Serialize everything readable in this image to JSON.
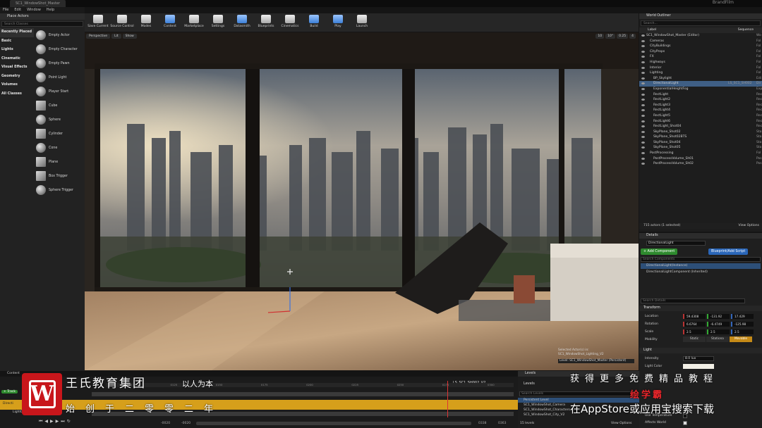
{
  "window": {
    "tab_title": "SC1_WindowShot_Master",
    "brand": "BrandFilm"
  },
  "menu": [
    "File",
    "Edit",
    "Window",
    "Help"
  ],
  "place_actors": {
    "title": "Place Actors",
    "search_placeholder": "Search Classes",
    "categories": [
      "Recently Placed",
      "Basic",
      "Lights",
      "Cinematic",
      "Visual Effects",
      "Geometry",
      "Volumes",
      "All Classes"
    ],
    "actors": [
      "Empty Actor",
      "Empty Character",
      "Empty Pawn",
      "Point Light",
      "Player Start",
      "Cube",
      "Sphere",
      "Cylinder",
      "Cone",
      "Plane",
      "Box Trigger",
      "Sphere Trigger"
    ]
  },
  "toolbar": [
    {
      "label": "Save Current",
      "icon": "save-icon"
    },
    {
      "label": "Source Control",
      "icon": "source-control-icon"
    },
    {
      "label": "Modes",
      "icon": "modes-icon"
    },
    {
      "label": "Content",
      "icon": "content-icon"
    },
    {
      "label": "Marketplace",
      "icon": "marketplace-icon"
    },
    {
      "label": "Settings",
      "icon": "settings-icon"
    },
    {
      "label": "Datasmith",
      "icon": "datasmith-icon"
    },
    {
      "label": "Blueprints",
      "icon": "blueprints-icon"
    },
    {
      "label": "Cinematics",
      "icon": "cinematics-icon"
    },
    {
      "label": "Build",
      "icon": "build-icon"
    },
    {
      "label": "Play",
      "icon": "play-icon"
    },
    {
      "label": "Launch",
      "icon": "launch-icon"
    }
  ],
  "viewport": {
    "perspective": "Perspective",
    "lit": "Lit",
    "show": "Show",
    "snap_grid": "10",
    "snap_angle": "10°",
    "snap_scale": "0.25",
    "cam_speed": "4",
    "info_selected": "Selected Actor(s) in:",
    "info_level": "SC1_WindowShot_Lighting_V2",
    "level_label": "Level:  SC1_WindowShot_Master (Persistent)"
  },
  "outliner": {
    "title": "World Outliner",
    "search_placeholder": "Search...",
    "col_label": "Label",
    "col_sequence": "Sequence",
    "rows": [
      {
        "label": "SC1_WindowShot_Master (Editor)",
        "seq": "",
        "type": "Wo"
      },
      {
        "label": "Cameras",
        "seq": "",
        "type": "Fol"
      },
      {
        "label": "CityBuildings",
        "seq": "",
        "type": "Fol"
      },
      {
        "label": "CityProps",
        "seq": "",
        "type": "Fol"
      },
      {
        "label": "FX",
        "seq": "",
        "type": "Fol"
      },
      {
        "label": "Highways",
        "seq": "",
        "type": "Fol"
      },
      {
        "label": "Interior",
        "seq": "",
        "type": "Fol"
      },
      {
        "label": "Lighting",
        "seq": "",
        "type": "Fol"
      },
      {
        "label": "BP_Skylight",
        "seq": "",
        "type": "Edi"
      },
      {
        "label": "DirectionalLight",
        "seq": "LS_SC1_SH002",
        "type": "Dir"
      },
      {
        "label": "ExponentialHeightFog",
        "seq": "",
        "type": "Exp"
      },
      {
        "label": "RectLight",
        "seq": "",
        "type": "Rec"
      },
      {
        "label": "RectLight2",
        "seq": "",
        "type": "Rec"
      },
      {
        "label": "RectLight3",
        "seq": "",
        "type": "Rec"
      },
      {
        "label": "RectLight4",
        "seq": "",
        "type": "Rec"
      },
      {
        "label": "RectLight5",
        "seq": "",
        "type": "Rec"
      },
      {
        "label": "RectLight6",
        "seq": "",
        "type": "Rec"
      },
      {
        "label": "RectLight_Shot04",
        "seq": "",
        "type": "Rec"
      },
      {
        "label": "SkyPlane_Shot02",
        "seq": "",
        "type": "Sta"
      },
      {
        "label": "SkyPlane_Shot02BTS",
        "seq": "",
        "type": "Sta"
      },
      {
        "label": "SkyPlane_Shot04",
        "seq": "",
        "type": "Sta"
      },
      {
        "label": "SkyPlane_Shot05",
        "seq": "",
        "type": "Sta"
      },
      {
        "label": "PostProcessing",
        "seq": "",
        "type": "Fol"
      },
      {
        "label": "PostProcessVolume_Sh01",
        "seq": "",
        "type": "Pos"
      },
      {
        "label": "PostProcessVolume_Sh02",
        "seq": "",
        "type": "Pos"
      }
    ],
    "footer": "715 actors (1 selected)",
    "view_options": "View Options"
  },
  "details": {
    "title": "Details",
    "name_value": "DirectionalLight",
    "add_component": "+ Add Component",
    "blueprint_btn": "Blueprint/Add Script",
    "search_components": "Search Components",
    "component_root": "DirectionalLight(Instance)",
    "component_child": "DirectionalLightComponent (Inherited)",
    "search_details": "Search Details",
    "transform_label": "Transform",
    "location_label": "Location",
    "location": [
      "59.4308",
      "-131.92",
      "17.429"
    ],
    "rotation_label": "Rotation",
    "rotation": [
      "6.6764",
      "-6.4749",
      "-125.98"
    ],
    "scale_label": "Scale",
    "scale": [
      "2.5",
      "2.5",
      "2.5"
    ],
    "mobility_label": "Mobility",
    "mobility_options": [
      "Static",
      "Stationa",
      "Movable"
    ],
    "light_label": "Light",
    "intensity_label": "Intensity",
    "intensity_value": "8.0 lux",
    "light_color_label": "Light Color",
    "use_temperature_label": "Use Temperature",
    "affects_world_label": "Affects World"
  },
  "sequencer": {
    "tab_label": "Content",
    "track_label": "+ Track",
    "sequence_name": "LS_SC1_SH002_V2",
    "track_row1": "Directi",
    "track_row2": "LightComponent",
    "frame_left": "-0020",
    "frame_left2": "-0020",
    "frame_right": "0338",
    "frame_right2": "0363",
    "ruler_ticks": [
      "0100",
      "0125",
      "0150",
      "0175",
      "0200",
      "0225",
      "0250",
      "0275",
      "0300"
    ]
  },
  "levels": {
    "title": "Levels",
    "dropdown": "Levels",
    "search_placeholder": "Search Levels",
    "rows": [
      "Persistent Level",
      "SC1_WindowShot_Camera",
      "SC1_WindowShot_Characters",
      "SC1_WindowShot_City_V2"
    ],
    "count": "15 levels",
    "view_options": "View Options"
  },
  "overlay": {
    "company": "王氏教育集团",
    "slogan": "以人为本",
    "founded": "始创于二零零二年",
    "promo_top": "获得更多免费精品教程",
    "promo_app": "绘学霸",
    "promo_bottom": "在AppStore或应用宝搜索下载",
    "logo_letter": "W"
  }
}
